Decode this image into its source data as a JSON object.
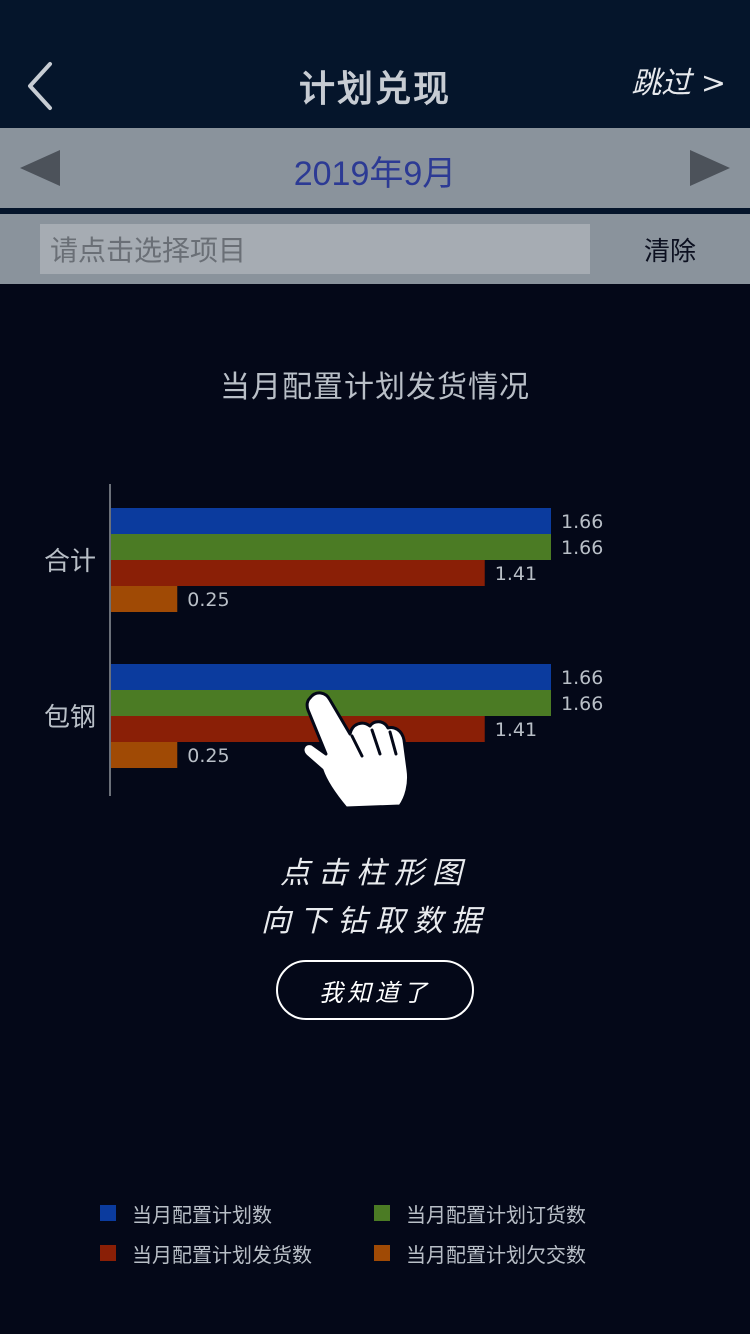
{
  "nav": {
    "title": "计划兑现",
    "skip_label": "跳过 >",
    "back_icon": "chevron-left-icon"
  },
  "month": {
    "label": "2019年9月",
    "prev_icon": "triangle-left-icon",
    "next_icon": "triangle-right-icon"
  },
  "filter": {
    "placeholder": "请点击选择项目",
    "clear_label": "清除"
  },
  "chart_data": {
    "type": "bar",
    "orientation": "horizontal",
    "title": "当月配置计划发货情况",
    "categories": [
      "合计",
      "包钢"
    ],
    "series": [
      {
        "name": "当月配置计划数",
        "color": "#0b3b9e",
        "values": [
          1.66,
          1.66
        ]
      },
      {
        "name": "当月配置计划订货数",
        "color": "#4b7b24",
        "values": [
          1.66,
          1.66
        ]
      },
      {
        "name": "当月配置计划发货数",
        "color": "#8a1f06",
        "values": [
          1.41,
          1.41
        ]
      },
      {
        "name": "当月配置计划欠交数",
        "color": "#a04a05",
        "values": [
          0.25,
          0.25
        ]
      }
    ],
    "value_labels": [
      [
        "1.66",
        "1.66",
        "1.41",
        "0.25"
      ],
      [
        "1.66",
        "1.66",
        "1.41",
        "0.25"
      ]
    ],
    "xlim": [
      0,
      1.66
    ],
    "grid": false,
    "legend": "bottom"
  },
  "hint": {
    "line1": "点击柱形图",
    "line2": "向下钻取数据",
    "button_label": "我知道了",
    "hand_icon": "pointing-hand-icon"
  }
}
